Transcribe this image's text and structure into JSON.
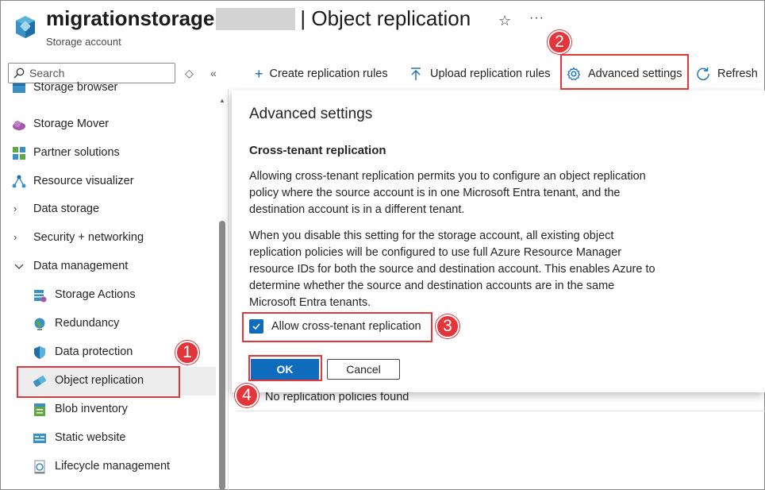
{
  "header": {
    "resource_name": "migrationstorage",
    "page_title": "| Object replication",
    "resource_type": "Storage account",
    "favorite_icon": "star-icon",
    "more_icon": "ellipsis-icon"
  },
  "sidebar": {
    "search_placeholder": "Search",
    "items": [
      {
        "label": "Storage browser",
        "icon": "storage-browser-icon"
      },
      {
        "label": "Storage Mover",
        "icon": "cloud-icon"
      },
      {
        "label": "Partner solutions",
        "icon": "partner-icon"
      },
      {
        "label": "Resource visualizer",
        "icon": "visualizer-icon"
      },
      {
        "label": "Data storage",
        "icon": "chevron-right-icon"
      },
      {
        "label": "Security + networking",
        "icon": "chevron-right-icon"
      },
      {
        "label": "Data management",
        "icon": "chevron-down-icon"
      },
      {
        "label": "Storage Actions",
        "icon": "storage-actions-icon"
      },
      {
        "label": "Redundancy",
        "icon": "globe-icon"
      },
      {
        "label": "Data protection",
        "icon": "shield-icon"
      },
      {
        "label": "Object replication",
        "icon": "replication-icon",
        "selected": true
      },
      {
        "label": "Blob inventory",
        "icon": "inventory-icon"
      },
      {
        "label": "Static website",
        "icon": "website-icon"
      },
      {
        "label": "Lifecycle management",
        "icon": "lifecycle-icon"
      }
    ]
  },
  "toolbar": {
    "create_label": "Create replication rules",
    "upload_label": "Upload replication rules",
    "advanced_label": "Advanced settings",
    "refresh_label": "Refresh"
  },
  "panel": {
    "title": "Advanced settings",
    "section_title": "Cross-tenant replication",
    "para1": "Allowing cross-tenant replication permits you to configure an object replication policy where the source account is in one Microsoft Entra tenant, and the destination account is in a different tenant.",
    "para2": "When you disable this setting for the storage account, all existing object replication policies will be configured to use full Azure Resource Manager resource IDs for both the source and destination account. This enables Azure to determine whether the source and destination accounts are in the same Microsoft Entra tenants.",
    "checkbox_label": "Allow cross-tenant replication",
    "checkbox_checked": true,
    "ok_label": "OK",
    "cancel_label": "Cancel"
  },
  "main": {
    "empty_message": "No replication policies found"
  },
  "callouts": [
    "1",
    "2",
    "3",
    "4"
  ],
  "colors": {
    "accent": "#0f6cbd",
    "highlight": "#e2363b",
    "selected_bg": "#ededed"
  }
}
